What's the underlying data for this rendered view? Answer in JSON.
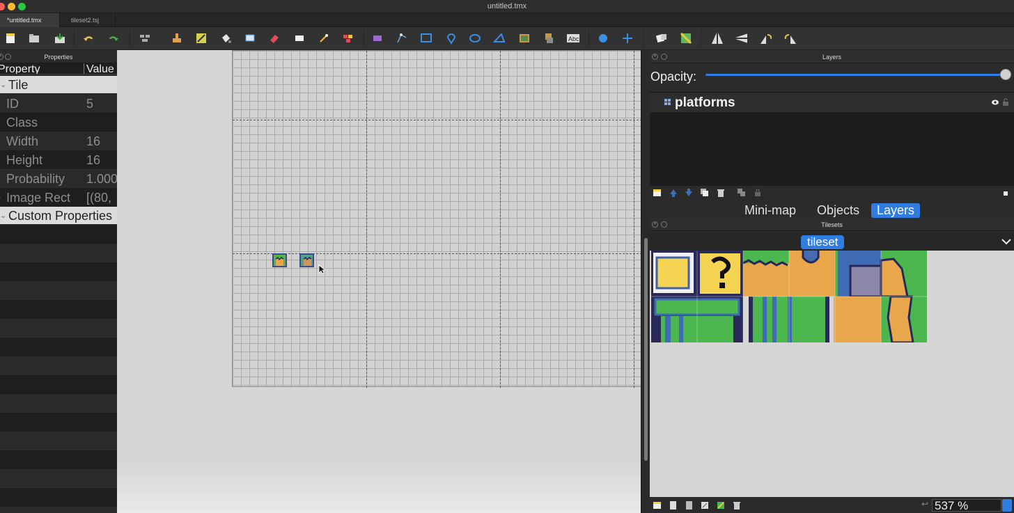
{
  "window": {
    "title": "untitled.tmx"
  },
  "tabs": [
    {
      "label": "*untitled.tmx"
    },
    {
      "label": "tileset2.tsj"
    }
  ],
  "toolbar": {
    "icons": [
      "new-map-icon",
      "open-icon",
      "save-icon",
      "undo-icon",
      "redo-icon",
      "world-tool-icon",
      "stamp-brush-icon",
      "terrain-brush-icon",
      "bucket-fill-icon",
      "shape-fill-icon",
      "eraser-icon",
      "rectangle-select-icon",
      "magic-wand-icon",
      "select-same-tile-icon",
      "select-objects-icon",
      "edit-polygons-icon",
      "insert-rectangle-icon",
      "insert-point-icon",
      "insert-ellipse-icon",
      "insert-polygon-icon",
      "insert-tile-icon",
      "insert-template-icon",
      "insert-text-icon",
      "layer-offset-icon",
      "move-icon",
      "random-mode-icon",
      "wang-fill-icon",
      "flip-horizontal-icon",
      "flip-vertical-icon",
      "rotate-left-icon",
      "rotate-right-icon"
    ]
  },
  "properties_panel": {
    "title": "Properties",
    "col_property": "Property",
    "col_value": "Value",
    "group_tile": "Tile",
    "rows": [
      {
        "key": "ID",
        "value": "5"
      },
      {
        "key": "Class",
        "value": ""
      },
      {
        "key": "Width",
        "value": "16"
      },
      {
        "key": "Height",
        "value": "16"
      },
      {
        "key": "Probability",
        "value": "1.000"
      },
      {
        "key": "Image Rect",
        "value": "[(80,"
      }
    ],
    "group_custom": "Custom Properties"
  },
  "layers_panel": {
    "title": "Layers",
    "opacity_label": "Opacity:",
    "opacity_value": 1.0,
    "layers": [
      {
        "name": "platforms"
      }
    ]
  },
  "dock_tabs": [
    {
      "label": "Mini-map",
      "selected": false
    },
    {
      "label": "Objects",
      "selected": false
    },
    {
      "label": "Layers",
      "selected": true
    }
  ],
  "tilesets_panel": {
    "title": "Tilesets",
    "active_tab": "tileset",
    "zoom": "537 %"
  },
  "colors": {
    "accent": "#2f7de1",
    "canvas": "#d2d2d2",
    "panel": "#2b2b2b"
  }
}
